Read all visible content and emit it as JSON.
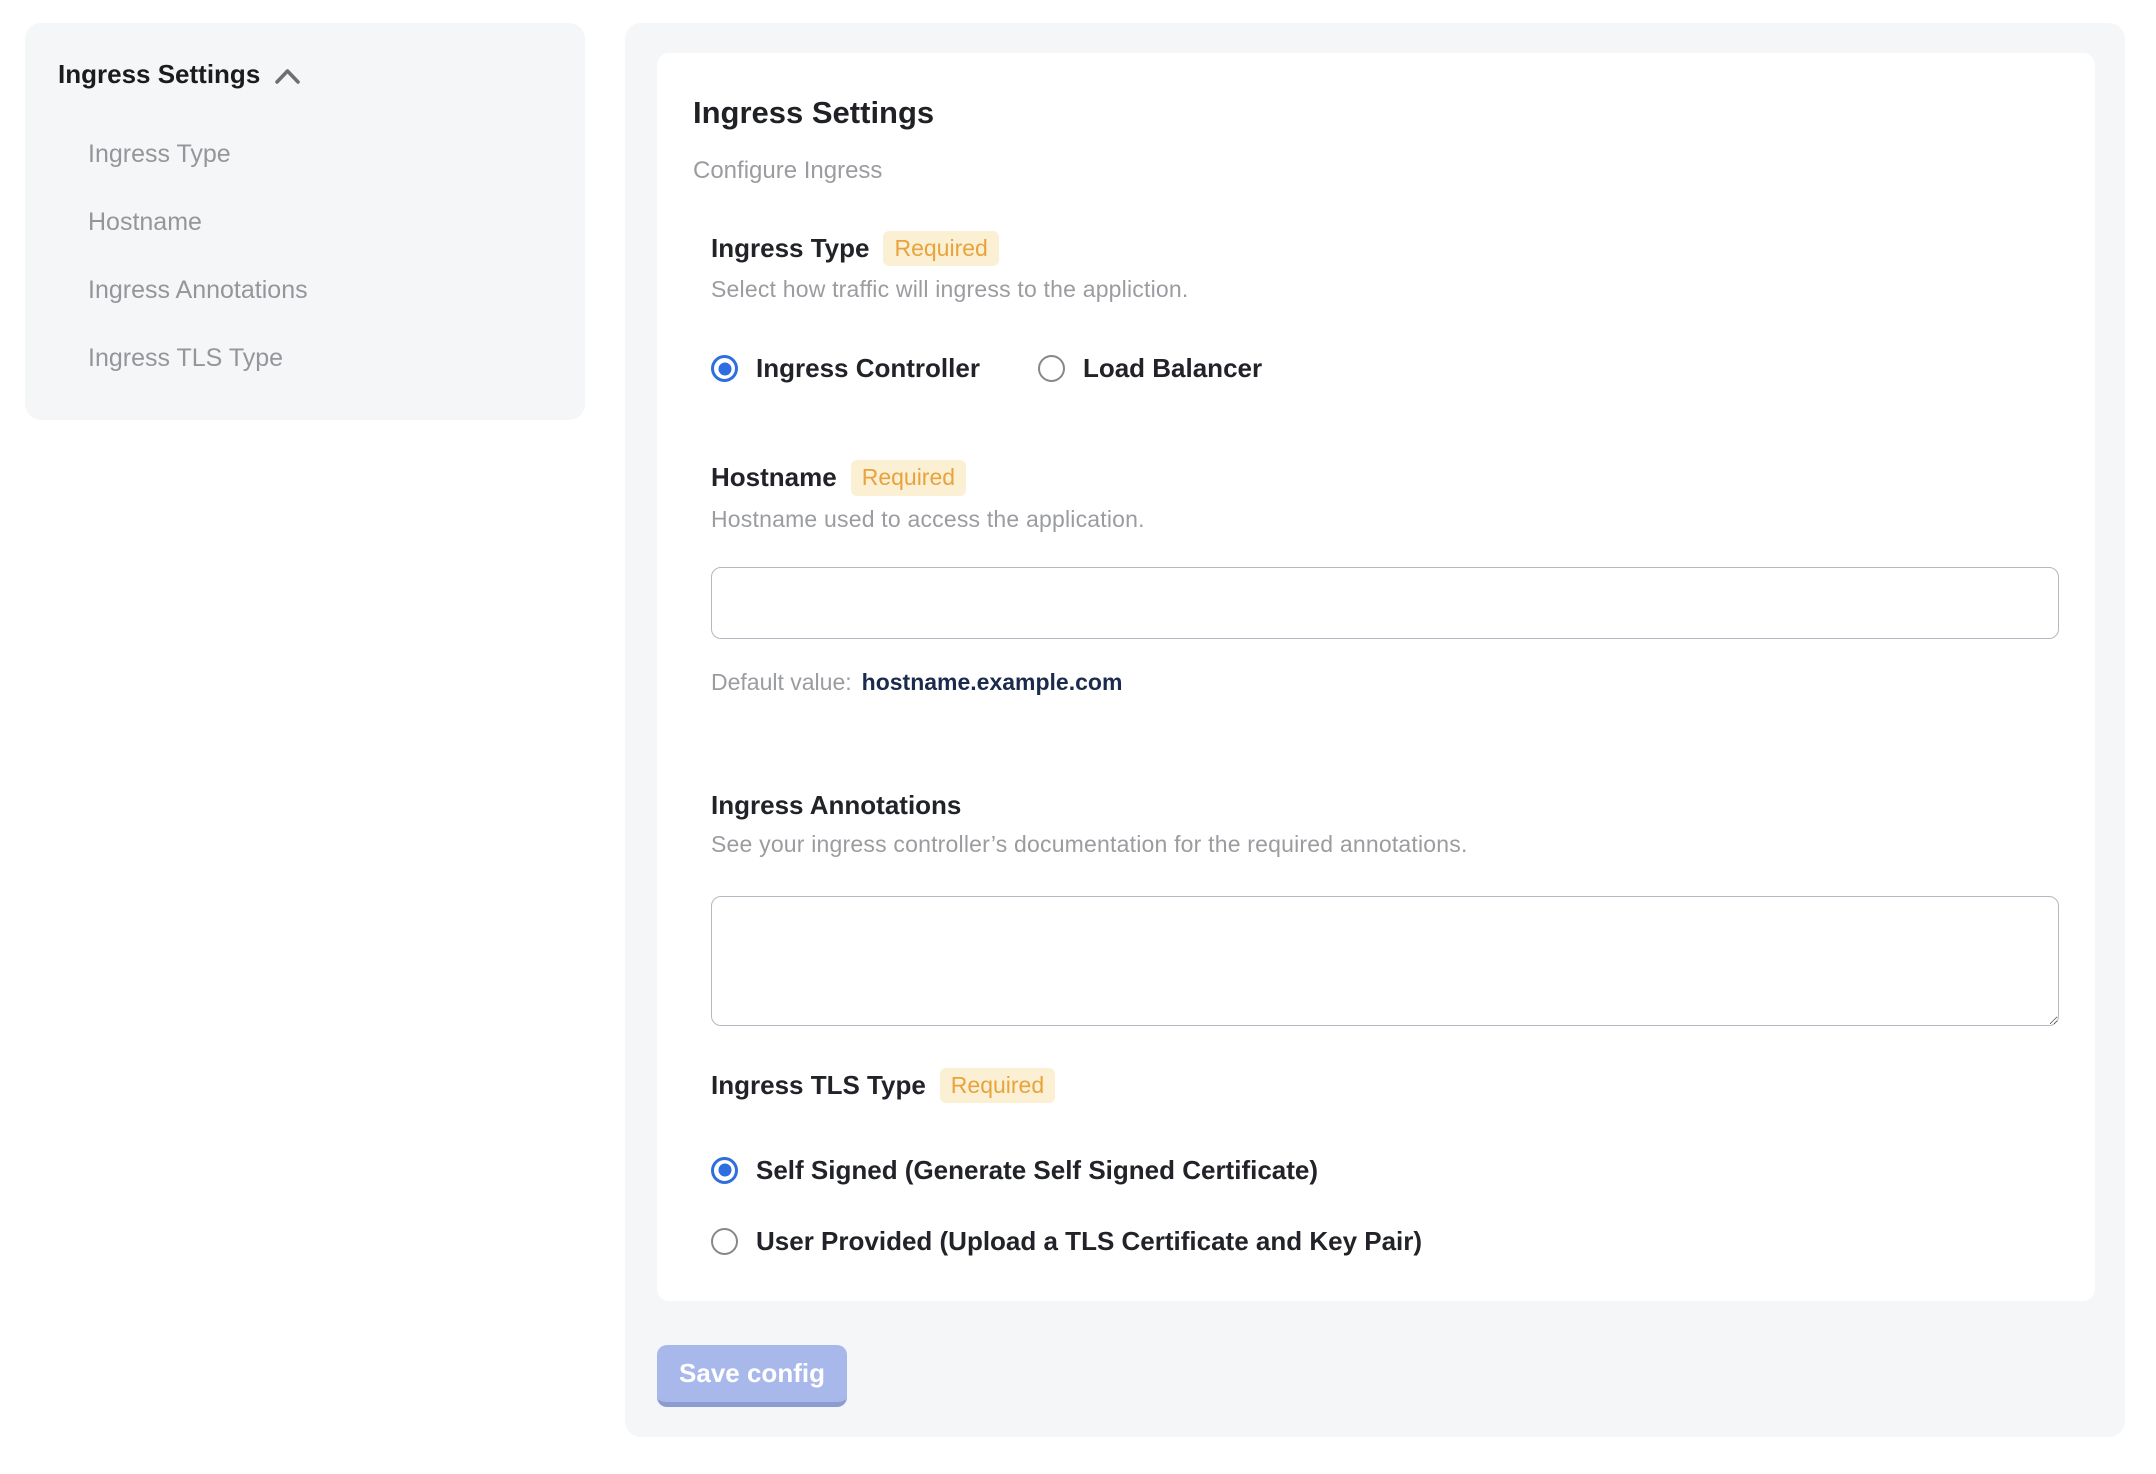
{
  "sidebar": {
    "title": "Ingress Settings",
    "items": [
      {
        "label": "Ingress Type"
      },
      {
        "label": "Hostname"
      },
      {
        "label": "Ingress Annotations"
      },
      {
        "label": "Ingress TLS Type"
      }
    ]
  },
  "panel": {
    "title": "Ingress Settings",
    "subtitle": "Configure Ingress",
    "sections": {
      "ingress_type": {
        "label": "Ingress Type",
        "required_badge": "Required",
        "description": "Select how traffic will ingress to the appliction.",
        "options": [
          {
            "label": "Ingress Controller",
            "selected": true
          },
          {
            "label": "Load Balancer",
            "selected": false
          }
        ]
      },
      "hostname": {
        "label": "Hostname",
        "required_badge": "Required",
        "description": "Hostname used to access the application.",
        "input_value": "",
        "default_value_label": "Default value:",
        "default_value": "hostname.example.com"
      },
      "annotations": {
        "label": "Ingress Annotations",
        "description": "See your ingress controller’s documentation for the required annotations.",
        "textarea_value": ""
      },
      "tls_type": {
        "label": "Ingress TLS Type",
        "required_badge": "Required",
        "options": [
          {
            "label": "Self Signed (Generate Self Signed Certificate)",
            "selected": true
          },
          {
            "label": "User Provided (Upload a TLS Certificate and Key Pair)",
            "selected": false
          }
        ]
      }
    },
    "save_button_label": "Save config"
  },
  "colors": {
    "accent_blue": "#2e6ee0",
    "badge_bg": "#fbf0d4",
    "badge_text": "#e8a33d",
    "panel_bg": "#f5f6f8",
    "save_button_bg": "#a9b8ea",
    "save_button_edge": "#8b9cd0",
    "default_value_text": "#1b2b4d"
  }
}
